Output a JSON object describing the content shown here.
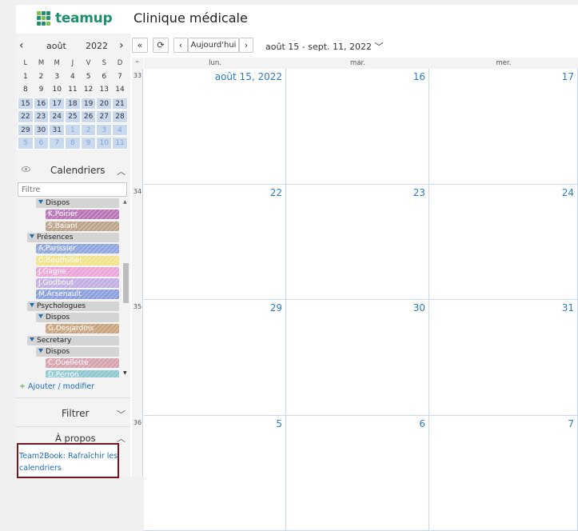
{
  "header": {
    "logo_text": "teamup",
    "title": "Clinique médicale"
  },
  "mini_calendar": {
    "prev": "‹",
    "next": "›",
    "month": "août",
    "year": "2022",
    "weekdays": [
      "L",
      "M",
      "M",
      "J",
      "V",
      "S",
      "D"
    ],
    "weeks": [
      [
        {
          "d": "1",
          "s": ""
        },
        {
          "d": "2",
          "s": ""
        },
        {
          "d": "3",
          "s": ""
        },
        {
          "d": "4",
          "s": ""
        },
        {
          "d": "5",
          "s": ""
        },
        {
          "d": "6",
          "s": ""
        },
        {
          "d": "7",
          "s": ""
        }
      ],
      [
        {
          "d": "8",
          "s": ""
        },
        {
          "d": "9",
          "s": ""
        },
        {
          "d": "10",
          "s": ""
        },
        {
          "d": "11",
          "s": ""
        },
        {
          "d": "12",
          "s": ""
        },
        {
          "d": "13",
          "s": ""
        },
        {
          "d": "14",
          "s": ""
        }
      ],
      [
        {
          "d": "15",
          "s": "hl"
        },
        {
          "d": "16",
          "s": "hl"
        },
        {
          "d": "17",
          "s": "hl"
        },
        {
          "d": "18",
          "s": "hl"
        },
        {
          "d": "19",
          "s": "hl"
        },
        {
          "d": "20",
          "s": "hl"
        },
        {
          "d": "21",
          "s": "hl"
        }
      ],
      [
        {
          "d": "22",
          "s": "hl"
        },
        {
          "d": "23",
          "s": "hl"
        },
        {
          "d": "24",
          "s": "hl"
        },
        {
          "d": "25",
          "s": "hl"
        },
        {
          "d": "26",
          "s": "hl"
        },
        {
          "d": "27",
          "s": "hl"
        },
        {
          "d": "28",
          "s": "hl"
        }
      ],
      [
        {
          "d": "29",
          "s": "hl"
        },
        {
          "d": "30",
          "s": "hl"
        },
        {
          "d": "31",
          "s": "hl"
        },
        {
          "d": "1",
          "s": "hl other"
        },
        {
          "d": "2",
          "s": "hl other"
        },
        {
          "d": "3",
          "s": "hl other"
        },
        {
          "d": "4",
          "s": "hl other"
        }
      ],
      [
        {
          "d": "5",
          "s": "hl other"
        },
        {
          "d": "6",
          "s": "hl other"
        },
        {
          "d": "7",
          "s": "hl other"
        },
        {
          "d": "8",
          "s": "hl other"
        },
        {
          "d": "9",
          "s": "hl other"
        },
        {
          "d": "10",
          "s": "hl other"
        },
        {
          "d": "11",
          "s": "hl other"
        }
      ]
    ]
  },
  "calendars": {
    "title": "Calendriers",
    "filter_placeholder": "Filtre",
    "items": [
      {
        "label": "Dispos",
        "kind": "folder",
        "indent": 2,
        "color": ""
      },
      {
        "label": "K.Poirier",
        "kind": "cal",
        "indent": 3,
        "color": "#b974b8"
      },
      {
        "label": "S.Baiani",
        "kind": "cal",
        "indent": 3,
        "color": "#bba48a"
      },
      {
        "label": "Présences",
        "kind": "folder",
        "indent": 1,
        "color": ""
      },
      {
        "label": "A.Parissier",
        "kind": "cal",
        "indent": 2,
        "color": "#8fa6e0"
      },
      {
        "label": "C.Bouthillier",
        "kind": "cal",
        "indent": 2,
        "color": "#f1e38a"
      },
      {
        "label": "J.Gagne",
        "kind": "cal",
        "indent": 2,
        "color": "#eba5d7"
      },
      {
        "label": "J.Godbout",
        "kind": "cal",
        "indent": 2,
        "color": "#c3aee3"
      },
      {
        "label": "M.Arsenault",
        "kind": "cal",
        "indent": 2,
        "color": "#8a9fdc"
      },
      {
        "label": "Psychologues",
        "kind": "folder",
        "indent": 1,
        "color": ""
      },
      {
        "label": "Dispos",
        "kind": "folder",
        "indent": 2,
        "color": ""
      },
      {
        "label": "G.Desjardins",
        "kind": "cal",
        "indent": 3,
        "color": "#c9a47d"
      },
      {
        "label": "Secretary",
        "kind": "folder",
        "indent": 1,
        "color": ""
      },
      {
        "label": "Dispos",
        "kind": "folder",
        "indent": 2,
        "color": ""
      },
      {
        "label": "C.Ouellette",
        "kind": "cal",
        "indent": 3,
        "color": "#d7a2b0"
      },
      {
        "label": "D.Perron",
        "kind": "cal",
        "indent": 3,
        "color": "#8fc8d0"
      }
    ],
    "add_label": "Ajouter / modifier"
  },
  "filter_section": {
    "title": "Filtrer"
  },
  "about_section": {
    "title": "À propos",
    "link": "Team2Book: Rafraîchir les calendriers"
  },
  "toolbar": {
    "collapse": "«",
    "refresh": "⟳",
    "prev": "‹",
    "today": "Aujourd'hui",
    "next": "›",
    "range": "août 15 - sept. 11, 2022"
  },
  "grid": {
    "day_headers": [
      "lun.",
      "mar.",
      "mer."
    ],
    "weeks": [
      {
        "num": "33",
        "days": [
          "août 15, 2022",
          "16",
          "17"
        ]
      },
      {
        "num": "34",
        "days": [
          "22",
          "23",
          "24"
        ]
      },
      {
        "num": "35",
        "days": [
          "29",
          "30",
          "31"
        ]
      },
      {
        "num": "36",
        "days": [
          "5",
          "6",
          "7"
        ]
      }
    ]
  }
}
